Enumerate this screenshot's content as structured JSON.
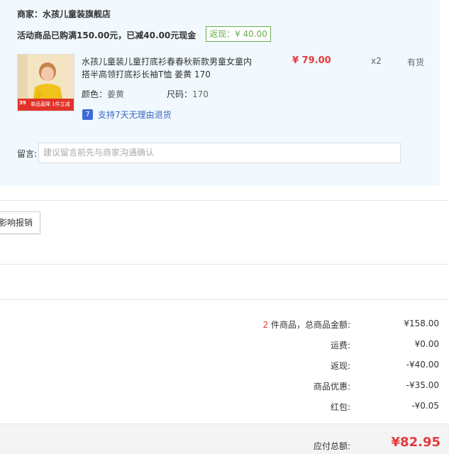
{
  "shop": {
    "merchant_label": "商家：水孩儿童装旗舰店",
    "promo_text": "活动商品已购满150.00元，已减40.00元现金",
    "rebate_badge": "返现：¥ 40.00"
  },
  "product": {
    "thumb_caption": "单品直降 1件立减",
    "thumb_tag": "39",
    "title": "水孩儿童装儿童打底衫春春秋新款男童女童内搭半高领打底衫长袖T恤 姜黄 170",
    "price": "¥ 79.00",
    "quantity": "x2",
    "stock": "有货",
    "color_label": "颜色：",
    "color_value": "姜黄",
    "size_label": "尺码：",
    "size_value": "170",
    "return_icon_text": "7",
    "return_policy": "支持7天无理由退货"
  },
  "message": {
    "label": "留言:",
    "placeholder": "建议留言前先与商家沟通确认"
  },
  "reimburse_button": "影响报销",
  "summary": {
    "count": "2",
    "count_suffix": " 件商品，总商品金额:",
    "goods_total": "¥158.00",
    "shipping_label": "运费:",
    "shipping_value": "¥0.00",
    "rebate_label": "返现:",
    "rebate_value": "-¥40.00",
    "discount_label": "商品优惠:",
    "discount_value": "-¥35.00",
    "redpacket_label": "红包:",
    "redpacket_value": "-¥0.05",
    "total_label": "应付总额:",
    "total_value": "¥82.95"
  },
  "colors": {
    "accent_red": "#e4393c",
    "badge_green": "#6ab04c",
    "panel_bg": "#f1f9fe",
    "link_blue": "#3a66c4"
  }
}
